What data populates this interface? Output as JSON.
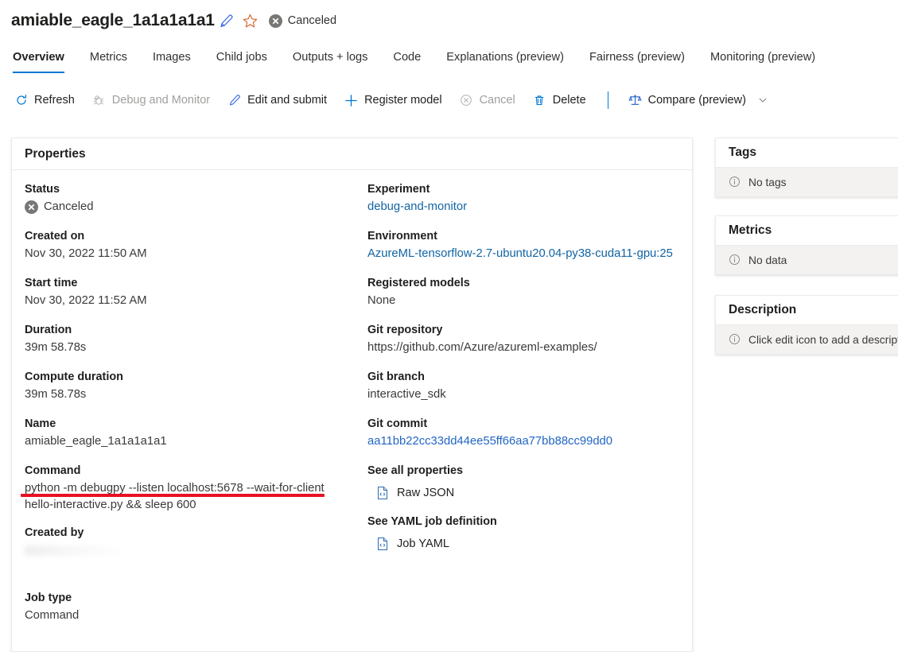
{
  "header": {
    "job_name": "amiable_eagle_1a1a1a1a1",
    "edit_icon": "pencil-icon",
    "favorite_icon": "star-icon",
    "status_icon": "cancel-circle-icon",
    "status_text": "Canceled"
  },
  "tabs": [
    {
      "label": "Overview",
      "active": true
    },
    {
      "label": "Metrics",
      "active": false
    },
    {
      "label": "Images",
      "active": false
    },
    {
      "label": "Child jobs",
      "active": false
    },
    {
      "label": "Outputs + logs",
      "active": false
    },
    {
      "label": "Code",
      "active": false
    },
    {
      "label": "Explanations (preview)",
      "active": false
    },
    {
      "label": "Fairness (preview)",
      "active": false
    },
    {
      "label": "Monitoring (preview)",
      "active": false
    }
  ],
  "commandbar": {
    "items": [
      {
        "label": "Refresh",
        "icon": "refresh-icon",
        "disabled": false
      },
      {
        "label": "Debug and Monitor",
        "icon": "bug-icon",
        "disabled": true
      },
      {
        "label": "Edit and submit",
        "icon": "pencil-icon",
        "disabled": false
      },
      {
        "label": "Register model",
        "icon": "plus-icon",
        "disabled": false
      },
      {
        "label": "Cancel",
        "icon": "cancel-circle-icon",
        "disabled": true
      },
      {
        "label": "Delete",
        "icon": "trash-icon",
        "disabled": false
      }
    ],
    "compare": {
      "label": "Compare (preview)",
      "icon": "scales-icon",
      "chevron": "chevron-down-icon"
    }
  },
  "properties": {
    "title": "Properties",
    "left": [
      {
        "label": "Status",
        "value": "Canceled",
        "kind": "status"
      },
      {
        "label": "Created on",
        "value": "Nov 30, 2022 11:50 AM",
        "kind": "text"
      },
      {
        "label": "Start time",
        "value": "Nov 30, 2022 11:52 AM",
        "kind": "text"
      },
      {
        "label": "Duration",
        "value": "39m 58.78s",
        "kind": "text"
      },
      {
        "label": "Compute duration",
        "value": "39m 58.78s",
        "kind": "text"
      },
      {
        "label": "Name",
        "value": "amiable_eagle_1a1a1a1a1",
        "kind": "text"
      },
      {
        "label": "Command",
        "value": "python -m debugpy --listen localhost:5678 --wait-for-client hello-interactive.py && sleep 600",
        "kind": "text"
      },
      {
        "label": "Created by",
        "value": "",
        "kind": "blank"
      },
      {
        "label": "Job type",
        "value": "Command",
        "kind": "text"
      }
    ],
    "right": [
      {
        "label": "Experiment",
        "value": "debug-and-monitor",
        "kind": "link"
      },
      {
        "label": "Environment",
        "value": "AzureML-tensorflow-2.7-ubuntu20.04-py38-cuda11-gpu:25",
        "kind": "link"
      },
      {
        "label": "Registered models",
        "value": "None",
        "kind": "text"
      },
      {
        "label": "Git repository",
        "value": "https://github.com/Azure/azureml-examples/",
        "kind": "text"
      },
      {
        "label": "Git branch",
        "value": "interactive_sdk",
        "kind": "text"
      },
      {
        "label": "Git commit",
        "value": "aa11bb22cc33dd44ee55ff66aa77bb88cc99dd0",
        "kind": "link"
      }
    ],
    "see_all_properties": {
      "label": "See all properties",
      "link": "Raw JSON",
      "icon": "json-file-icon"
    },
    "see_yaml": {
      "label": "See YAML job definition",
      "link": "Job YAML",
      "icon": "yaml-file-icon"
    }
  },
  "rail": [
    {
      "title": "Tags",
      "empty_text": "No tags",
      "icon": "info-icon"
    },
    {
      "title": "Metrics",
      "empty_text": "No data",
      "icon": "info-icon"
    },
    {
      "title": "Description",
      "empty_text": "Click edit icon to add a description",
      "icon": "info-icon"
    }
  ],
  "annotation": {
    "type": "red-underline",
    "color": "#e81123"
  },
  "colors": {
    "accent": "#0078d4",
    "link": "#1264a3",
    "status_gray": "#797775",
    "annotation_red": "#e81123"
  }
}
